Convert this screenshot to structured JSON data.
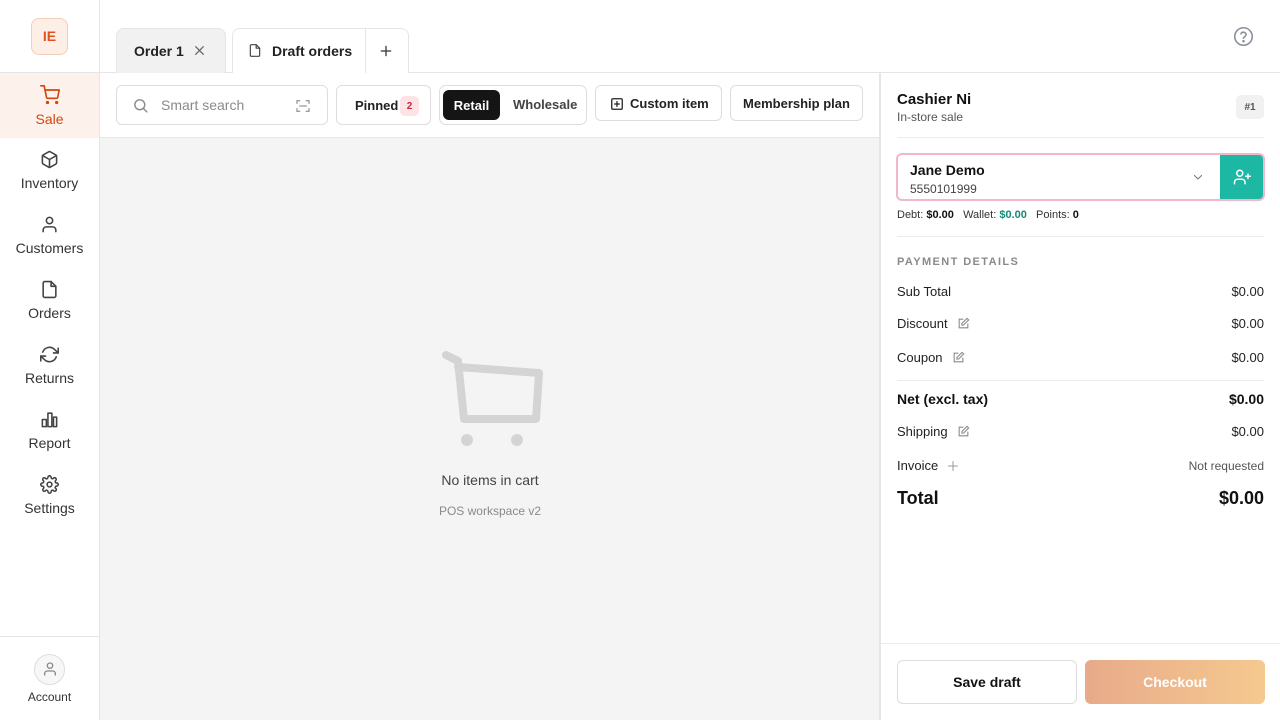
{
  "app": {
    "logo_text": "IE"
  },
  "nav": {
    "items": [
      {
        "label": "Sale",
        "icon": "cart-icon",
        "active": true
      },
      {
        "label": "Inventory",
        "icon": "box-icon"
      },
      {
        "label": "Customers",
        "icon": "user-icon"
      },
      {
        "label": "Orders",
        "icon": "document-icon"
      },
      {
        "label": "Returns",
        "icon": "refresh-icon"
      },
      {
        "label": "Report",
        "icon": "bar-chart-icon"
      },
      {
        "label": "Settings",
        "icon": "gear-icon"
      }
    ],
    "account_label": "Account"
  },
  "tabs": [
    {
      "label": "Order 1",
      "active": true,
      "closable": true
    },
    {
      "label": "Draft orders",
      "icon": "document-icon"
    }
  ],
  "toolbar": {
    "search_placeholder": "Smart search",
    "pinned_label": "Pinned",
    "pinned_count": "2",
    "mode_options": [
      "Retail",
      "Wholesale"
    ],
    "mode_selected": "Retail",
    "custom_item_label": "Custom item",
    "membership_label": "Membership plan"
  },
  "cart": {
    "empty_title": "No items in cart",
    "empty_subtitle": "POS workspace v2"
  },
  "panel": {
    "cashier": "Cashier Ni",
    "sale_type": "In-store sale",
    "order_number": "#1",
    "customer": {
      "name": "Jane Demo",
      "phone": "5550101999",
      "debt_label": "Debt:",
      "debt": "$0.00",
      "wallet_label": "Wallet:",
      "wallet": "$0.00",
      "points_label": "Points:",
      "points": "0"
    },
    "payment_title": "PAYMENT DETAILS",
    "subtotal_label": "Sub Total",
    "subtotal": "$0.00",
    "discount_label": "Discount",
    "discount": "$0.00",
    "coupon_label": "Coupon",
    "coupon": "$0.00",
    "net_label": "Net (excl. tax)",
    "net": "$0.00",
    "shipping_label": "Shipping",
    "shipping": "$0.00",
    "invoice_label": "Invoice",
    "invoice_status": "Not requested",
    "total_label": "Total",
    "total": "$0.00",
    "save_draft_label": "Save draft",
    "checkout_label": "Checkout"
  },
  "colors": {
    "accent": "#d3470f",
    "teal": "#1cb8a4",
    "checkout_gradient_start": "#e8aa8a",
    "checkout_gradient_end": "#f5c98f"
  }
}
